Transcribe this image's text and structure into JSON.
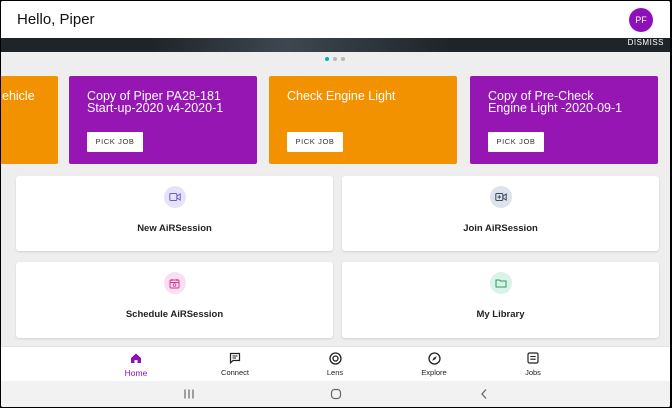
{
  "header": {
    "greeting": "Hello, Piper",
    "avatar_initials": "PF"
  },
  "banner": {
    "dismiss_label": "DISMISS"
  },
  "jobs": [
    {
      "title": "ehicle",
      "button": "",
      "color": "#f39200"
    },
    {
      "title": "Copy of Piper PA28-181\nStart-up-2020 v4-2020-1",
      "button": "PICK JOB",
      "color": "#9616b4"
    },
    {
      "title": "Check Engine Light",
      "button": "PICK JOB",
      "color": "#f39200"
    },
    {
      "title": "Copy of Pre-Check\nEngine Light -2020-09-1",
      "button": "PICK JOB",
      "color": "#9616b4"
    }
  ],
  "actions": {
    "new_session": "New AiRSession",
    "join_session": "Join AiRSession",
    "schedule_session": "Schedule AiRSession",
    "library": "My Library"
  },
  "nav": {
    "home": "Home",
    "connect": "Connect",
    "lens": "Lens",
    "explore": "Explore",
    "jobs": "Jobs"
  },
  "colors": {
    "brand_purple": "#8e10b8",
    "brand_orange": "#f39200",
    "carousel_active": "#00b0b9"
  }
}
